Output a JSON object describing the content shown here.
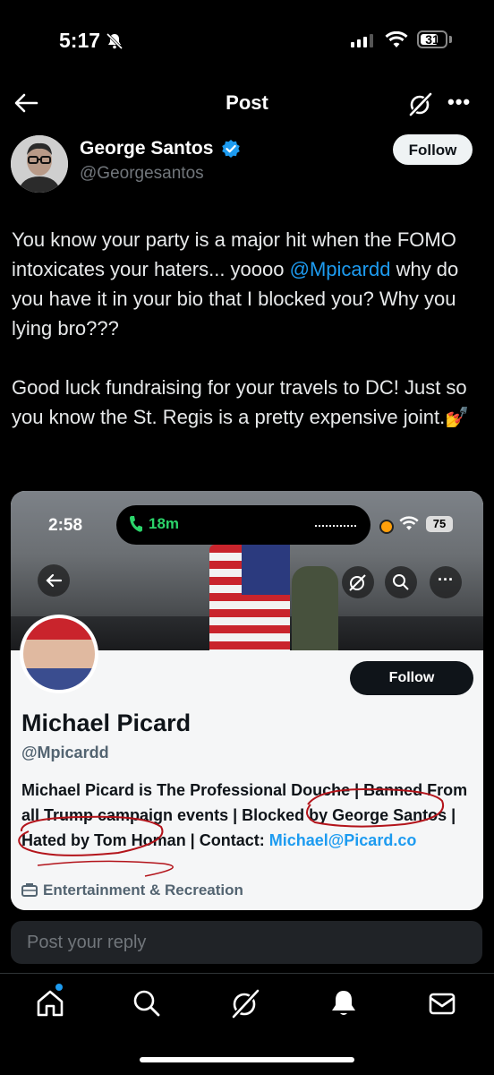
{
  "status_bar": {
    "time": "5:17",
    "battery": "31"
  },
  "header": {
    "title": "Post"
  },
  "author": {
    "name": "George Santos",
    "handle": "@Georgesantos",
    "follow_label": "Follow"
  },
  "tweet": {
    "para1_a": "You know your party is a major hit when the FOMO intoxicates your haters... yoooo ",
    "mention": "@Mpicardd",
    "para1_b": " why do you have it in your bio that I blocked you? Why you lying bro???",
    "para2": "Good luck fundraising for your travels to DC! Just so you know the St. Regis is a pretty expensive joint.",
    "emoji": "💅"
  },
  "embed": {
    "status_time": "2:58",
    "call_time": "18m",
    "battery": "75",
    "follow_label": "Follow",
    "name": "Michael Picard",
    "handle": "@Mpicardd",
    "bio_text": "Michael Picard is The Professional Douche | Banned From all Trump campaign events | Blocked by George Santos | Hated by Tom Homan | Contact: ",
    "bio_link": "Michael@Picard.co",
    "category": "Entertainment & Recreation"
  },
  "reply": {
    "placeholder": "Post your reply"
  },
  "colors": {
    "accent": "#1d9bf0",
    "verified": "#1d9bf0",
    "background": "#000000",
    "annotation": "#b3141b"
  },
  "icons": [
    "back-arrow-icon",
    "grok-icon",
    "more-icon",
    "verified-icon",
    "home-icon",
    "search-icon",
    "grok-nav-icon",
    "bell-icon",
    "mail-icon"
  ]
}
